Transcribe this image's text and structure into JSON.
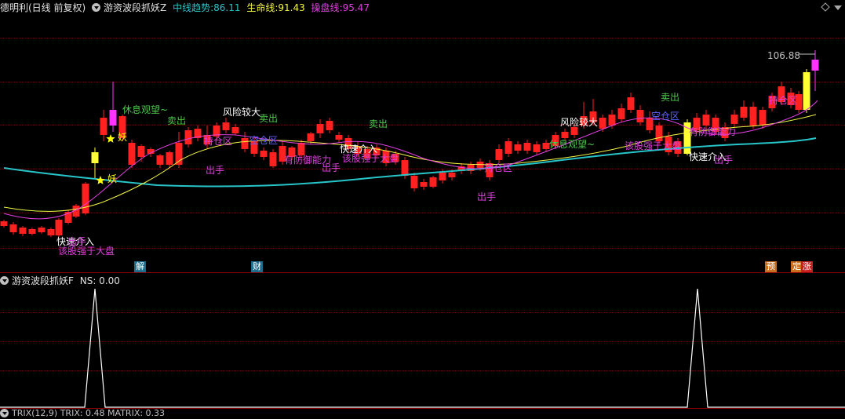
{
  "header_main": {
    "stock": "德明利(日线 前复权)",
    "indicator": "游资波段抓妖Z",
    "items": [
      {
        "label": "中线趋势:",
        "value": "86.11",
        "color": "#27c5c9"
      },
      {
        "label": "生命线:",
        "value": "91.43",
        "color": "#f5f542"
      },
      {
        "label": "操盘线:",
        "value": "95.47",
        "color": "#e040e0"
      }
    ]
  },
  "header_sub": {
    "title": "游资波段抓妖F",
    "value": "NS: 0.00"
  },
  "header_bottom": {
    "text": "TRIX(12,9)  TRIX: 0.48  MATRIX: 0.33"
  },
  "price_high_label": "106.88",
  "labels": [
    {
      "text": "休息观望~",
      "color": "#4cc84c"
    },
    {
      "text": "卖出",
      "color": "#4cc84c"
    },
    {
      "text": "风险较大",
      "color": "#ffffff"
    },
    {
      "text": "卖出",
      "color": "#4cc84c"
    },
    {
      "text": "持仓区",
      "color": "#e040e0"
    },
    {
      "text": "空仓区",
      "color": "#6060ff"
    },
    {
      "text": "出手",
      "color": "#e040e0"
    },
    {
      "text": "有防御能力",
      "color": "#e040e0"
    },
    {
      "text": "出手",
      "color": "#e040e0"
    },
    {
      "text": "该股强于大盘",
      "color": "#e040e0"
    },
    {
      "text": "快速介入",
      "color": "#ffffff"
    },
    {
      "text": "卖出",
      "color": "#4cc84c"
    },
    {
      "text": "持仓区",
      "color": "#e040e0"
    },
    {
      "text": "出手",
      "color": "#e040e0"
    },
    {
      "text": "休息观望~",
      "color": "#4cc84c"
    },
    {
      "text": "风险较大",
      "color": "#ffffff"
    },
    {
      "text": "空仓区",
      "color": "#6060ff"
    },
    {
      "text": "卖出",
      "color": "#4cc84c"
    },
    {
      "text": "该股强于大盘",
      "color": "#e040e0"
    },
    {
      "text": "快速介入",
      "color": "#ffffff"
    },
    {
      "text": "有防御能力",
      "color": "#e040e0"
    },
    {
      "text": "出手",
      "color": "#e040e0"
    },
    {
      "text": "持仓区",
      "color": "#e040e0"
    },
    {
      "text": "快速介入",
      "color": "#ffffff"
    },
    {
      "text": "该股强于大盘",
      "color": "#e040e0"
    },
    {
      "text": "出手",
      "color": "#e040e0"
    },
    {
      "text": "妖",
      "color": "#ffff00"
    },
    {
      "text": "妖",
      "color": "#ffff00"
    }
  ],
  "bottom_tags": [
    {
      "text": "解",
      "bg": "#1e6c8c",
      "color": "#ffffff"
    },
    {
      "text": "财",
      "bg": "#1e6c8c",
      "color": "#ffffff"
    },
    {
      "text": "预",
      "bg": "#c86e1e",
      "color": "#ffffff"
    },
    {
      "text": "定",
      "bg": "#c86e1e",
      "color": "#ffffff"
    },
    {
      "text": "涨",
      "bg": "#c81e1e",
      "color": "#ffffff"
    }
  ],
  "colors": {
    "up": "#ff2020",
    "ma_cyan": "#27c5c9",
    "ma_yellow": "#f5f542",
    "ma_magenta": "#e040e0",
    "border": "#8b0000"
  }
}
